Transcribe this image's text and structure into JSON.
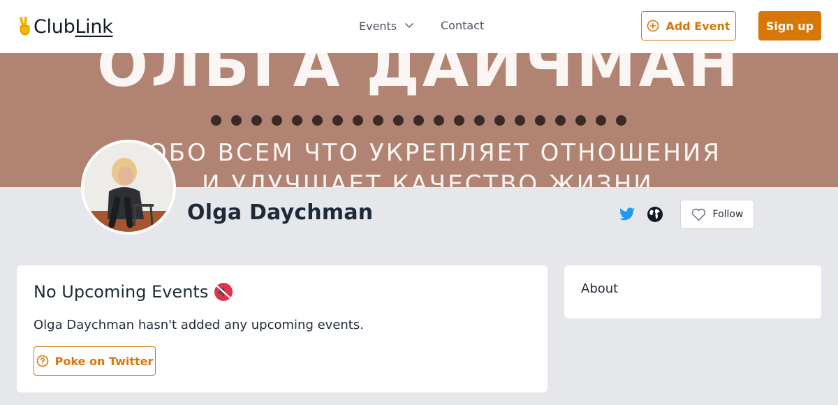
{
  "header": {
    "logo": {
      "prefix": "Club",
      "suffix": "Link",
      "icon": "victory-hand-icon"
    },
    "nav": {
      "events_label": "Events",
      "contact_label": "Contact"
    },
    "add_event_label": "Add Event",
    "signup_label": "Sign up"
  },
  "banner": {
    "title": "ОЛЬГА ДАЙЧМАН",
    "line1": "ОБО ВСЕМ ЧТО УКРЕПЛЯЕТ ОТНОШЕНИЯ",
    "line2": "И УЛУЧШАЕТ КАЧЕСТВО ЖИЗНИ",
    "dot_count": 21
  },
  "profile": {
    "name": "Olga Daychman",
    "follow_label": "Follow",
    "links": [
      "twitter-icon",
      "globe-icon"
    ]
  },
  "events_card": {
    "title": "No Upcoming Events",
    "title_icon": "muted-speaker-icon",
    "message": "Olga Daychman hasn't added any upcoming events.",
    "poke_label": "Poke on Twitter"
  },
  "about_card": {
    "title": "About"
  },
  "colors": {
    "accent": "#d97706",
    "page_bg": "#e5e7eb",
    "banner_bg": "#b08373",
    "twitter": "#1d9bf0"
  }
}
